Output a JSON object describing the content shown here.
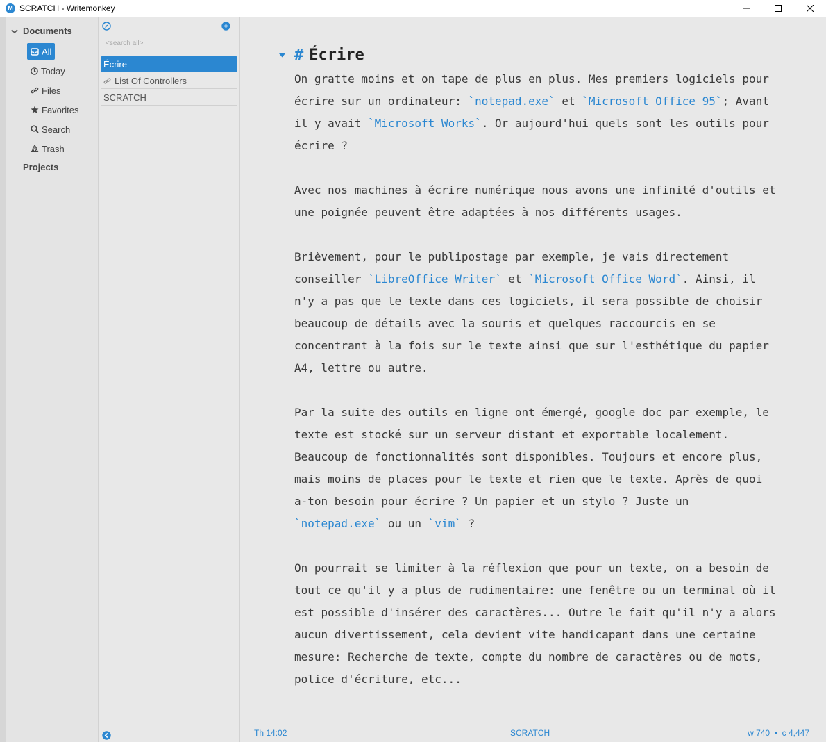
{
  "window": {
    "title": "SCRATCH - Writemonkey",
    "app_icon_letter": "M",
    "controls": [
      "minimize",
      "maximize",
      "close"
    ]
  },
  "sidebar": {
    "section_label": "Documents",
    "items": [
      {
        "label": "All",
        "icon": "inbox-icon",
        "active": true
      },
      {
        "label": "Today",
        "icon": "clock-icon",
        "active": false
      },
      {
        "label": "Files",
        "icon": "link-icon",
        "active": false
      },
      {
        "label": "Favorites",
        "icon": "star-icon",
        "active": false
      },
      {
        "label": "Search",
        "icon": "search-icon",
        "active": false
      },
      {
        "label": "Trash",
        "icon": "recycle-icon",
        "active": false
      }
    ],
    "projects_label": "Projects"
  },
  "filelist": {
    "search_placeholder": "<search all>",
    "files": [
      {
        "label": "Écrire",
        "selected": true,
        "linked": false
      },
      {
        "label": "List Of Controllers",
        "selected": false,
        "linked": true
      },
      {
        "label": "SCRATCH",
        "selected": false,
        "linked": false
      }
    ]
  },
  "document": {
    "heading_marker": "#",
    "heading": "Écrire",
    "paragraphs": [
      [
        {
          "t": "On gratte moins et on tape de plus en plus. Mes premiers logiciels pour écrire sur un ordinateur: "
        },
        {
          "c": "`notepad.exe`"
        },
        {
          "t": " et "
        },
        {
          "c": "`Microsoft Office 95`"
        },
        {
          "t": "; Avant il y avait "
        },
        {
          "c": "`Microsoft Works`"
        },
        {
          "t": ". Or aujourd'hui quels sont les outils pour écrire ?"
        }
      ],
      [
        {
          "t": "Avec nos machines à écrire numérique nous avons une infinité d'outils et une poignée peuvent être adaptées à nos différents usages."
        }
      ],
      [
        {
          "t": "Brièvement, pour le publipostage par exemple, je vais directement conseiller "
        },
        {
          "c": "`LibreOffice Writer`"
        },
        {
          "t": " et "
        },
        {
          "c": "`Microsoft Office Word`"
        },
        {
          "t": ". Ainsi, il n'y a pas que le texte dans ces logiciels, il sera possible de choisir beaucoup de détails avec la souris et quelques raccourcis en se concentrant à la fois sur le texte ainsi que sur l'esthétique du papier A4, lettre ou autre."
        }
      ],
      [
        {
          "t": "Par la suite des outils en ligne ont émergé, google doc par exemple, le texte est stocké sur un serveur distant et exportable localement. Beaucoup de fonctionnalités sont disponibles. Toujours et encore plus, mais moins de places pour le texte et rien que le texte. Après de quoi a-ton besoin pour écrire ? Un papier et un stylo ? Juste un "
        },
        {
          "c": "`notepad.exe`"
        },
        {
          "t": " ou un "
        },
        {
          "c": "`vim`"
        },
        {
          "t": " ?"
        }
      ],
      [
        {
          "t": "On pourrait se limiter à la réflexion que pour un texte, on a besoin de tout ce qu'il y a plus de rudimentaire: une fenêtre ou un terminal où il est possible d'insérer des caractères... Outre le fait qu'il n'y a alors aucun divertissement, cela devient vite handicapant dans une certaine mesure: Recherche de texte, compte du nombre de caractères ou de mots, police d'écriture, etc..."
        }
      ]
    ]
  },
  "statusbar": {
    "time": "Th 14:02",
    "doc_name": "SCRATCH",
    "stats": "w 740  •  c 4,447"
  },
  "colors": {
    "accent": "#2b87d1",
    "background": "#e8e8e8",
    "text": "#3a3a3a"
  }
}
